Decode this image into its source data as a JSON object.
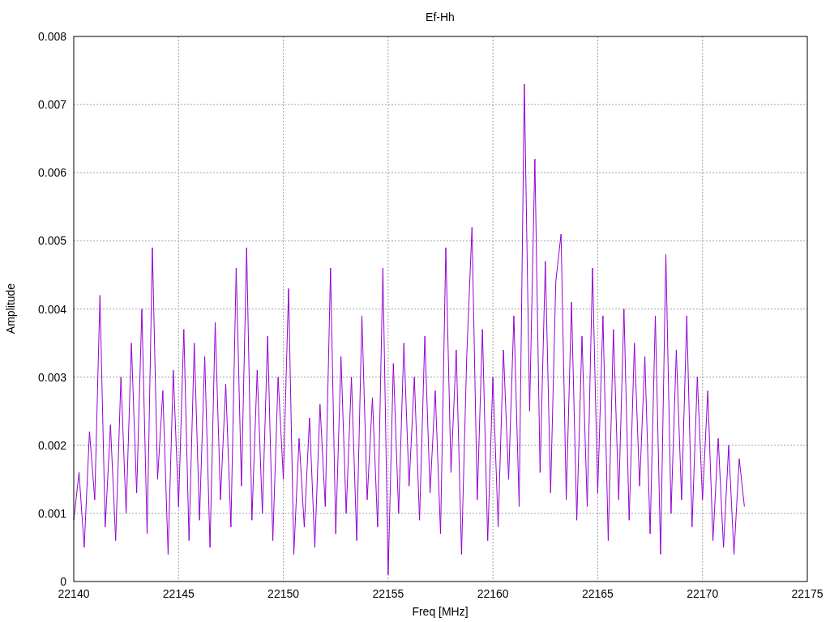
{
  "plot": {
    "chart_data": {
      "type": "line",
      "title": "Ef-Hh",
      "xlabel": "Freq [MHz]",
      "ylabel": "Amplitude",
      "grid": true,
      "xlim": [
        22140,
        22175
      ],
      "ylim": [
        0,
        0.008
      ],
      "xticks": [
        22140,
        22145,
        22150,
        22155,
        22160,
        22165,
        22170,
        22175
      ],
      "yticks": [
        0,
        0.001,
        0.002,
        0.003,
        0.004,
        0.005,
        0.006,
        0.007,
        0.008
      ],
      "x": [
        22140,
        22140.25,
        22140.5,
        22140.75,
        22141,
        22141.25,
        22141.5,
        22141.75,
        22142,
        22142.25,
        22142.5,
        22142.75,
        22143,
        22143.25,
        22143.5,
        22143.75,
        22144,
        22144.25,
        22144.5,
        22144.75,
        22145,
        22145.25,
        22145.5,
        22145.75,
        22146,
        22146.25,
        22146.5,
        22146.75,
        22147,
        22147.25,
        22147.5,
        22147.75,
        22148,
        22148.25,
        22148.5,
        22148.75,
        22149,
        22149.25,
        22149.5,
        22149.75,
        22150,
        22150.25,
        22150.5,
        22150.75,
        22151,
        22151.25,
        22151.5,
        22151.75,
        22152,
        22152.25,
        22152.5,
        22152.75,
        22153,
        22153.25,
        22153.5,
        22153.75,
        22154,
        22154.25,
        22154.5,
        22154.75,
        22155,
        22155.25,
        22155.5,
        22155.75,
        22156,
        22156.25,
        22156.5,
        22156.75,
        22157,
        22157.25,
        22157.5,
        22157.75,
        22158,
        22158.25,
        22158.5,
        22158.75,
        22159,
        22159.25,
        22159.5,
        22159.75,
        22160,
        22160.25,
        22160.5,
        22160.75,
        22161,
        22161.25,
        22161.5,
        22161.75,
        22162,
        22162.25,
        22162.5,
        22162.75,
        22163,
        22163.25,
        22163.5,
        22163.75,
        22164,
        22164.25,
        22164.5,
        22164.75,
        22165,
        22165.25,
        22165.5,
        22165.75,
        22166,
        22166.25,
        22166.5,
        22166.75,
        22167,
        22167.25,
        22167.5,
        22167.75,
        22168,
        22168.25,
        22168.5,
        22168.75,
        22169,
        22169.25,
        22169.5,
        22169.75,
        22170,
        22170.25,
        22170.5,
        22170.75,
        22171,
        22171.25,
        22171.5,
        22171.75,
        22172
      ],
      "series": [
        {
          "color": "#9400d3",
          "values": [
            0.0009,
            0.0016,
            0.0005,
            0.0022,
            0.0012,
            0.0042,
            0.0008,
            0.0023,
            0.0006,
            0.003,
            0.001,
            0.0035,
            0.0013,
            0.004,
            0.0007,
            0.0049,
            0.0015,
            0.0028,
            0.0004,
            0.0031,
            0.0011,
            0.0037,
            0.0006,
            0.0035,
            0.0009,
            0.0033,
            0.0005,
            0.0038,
            0.0012,
            0.0029,
            0.0008,
            0.0046,
            0.0014,
            0.0049,
            0.0009,
            0.0031,
            0.001,
            0.0036,
            0.0006,
            0.003,
            0.0015,
            0.0043,
            0.0004,
            0.0021,
            0.0008,
            0.0024,
            0.0005,
            0.0026,
            0.0011,
            0.0046,
            0.0007,
            0.0033,
            0.001,
            0.003,
            0.0006,
            0.0039,
            0.0012,
            0.0027,
            0.0008,
            0.0046,
            0.0001,
            0.0032,
            0.001,
            0.0035,
            0.0014,
            0.003,
            0.0009,
            0.0036,
            0.0013,
            0.0028,
            0.0007,
            0.0049,
            0.0016,
            0.0034,
            0.0004,
            0.0033,
            0.0052,
            0.0012,
            0.0037,
            0.0006,
            0.003,
            0.0008,
            0.0034,
            0.0015,
            0.0039,
            0.0011,
            0.0073,
            0.0025,
            0.0062,
            0.0016,
            0.0047,
            0.0013,
            0.0044,
            0.0051,
            0.0012,
            0.0041,
            0.0009,
            0.0036,
            0.0011,
            0.0046,
            0.0013,
            0.0039,
            0.0006,
            0.0037,
            0.0012,
            0.004,
            0.0009,
            0.0035,
            0.0014,
            0.0033,
            0.0007,
            0.0039,
            0.0004,
            0.0048,
            0.001,
            0.0034,
            0.0012,
            0.0039,
            0.0008,
            0.003,
            0.0012,
            0.0028,
            0.0006,
            0.0021,
            0.0005,
            0.002,
            0.0004,
            0.0018,
            0.0011
          ]
        }
      ]
    }
  }
}
